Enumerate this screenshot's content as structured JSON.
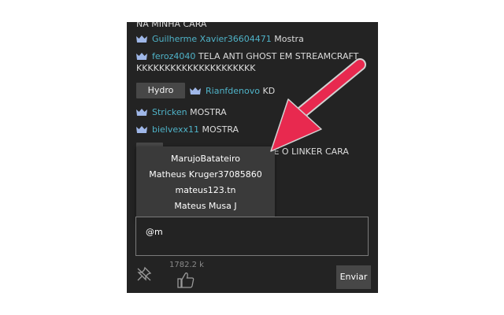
{
  "chat": {
    "messages": [
      {
        "user": "",
        "text": "NA MINHA CARA"
      },
      {
        "user": "Guilherme Xavier36604471",
        "text": " Mostra"
      },
      {
        "user": "feroz4040",
        "text": " TELA ANTI GHOST EM STREAMCRAFT KKKKKKKKKKKKKKKKKKKKK"
      },
      {
        "badge": "Hydro",
        "user": "Rianfdenovo",
        "text": " KD"
      },
      {
        "user": "Stricken",
        "text": " MOSTRA"
      },
      {
        "user": "bielvexx11",
        "text": " MOSTRA"
      },
      {
        "text": "DE O LINKER CARA"
      }
    ]
  },
  "suggestions": [
    "MarujoBatateiro",
    "Matheus Kruger37085860",
    "mateus123.tn",
    "Mateus Musa J"
  ],
  "input": {
    "value": "@m"
  },
  "footer": {
    "like_count": "1782.2 k",
    "send_label": "Enviar"
  },
  "colors": {
    "background": "#232323",
    "username": "#4fb3c8",
    "arrow": "#e8294f"
  },
  "icons": {
    "crown": "crown-icon",
    "pin": "pin-off-icon",
    "like": "thumbs-up-icon"
  }
}
